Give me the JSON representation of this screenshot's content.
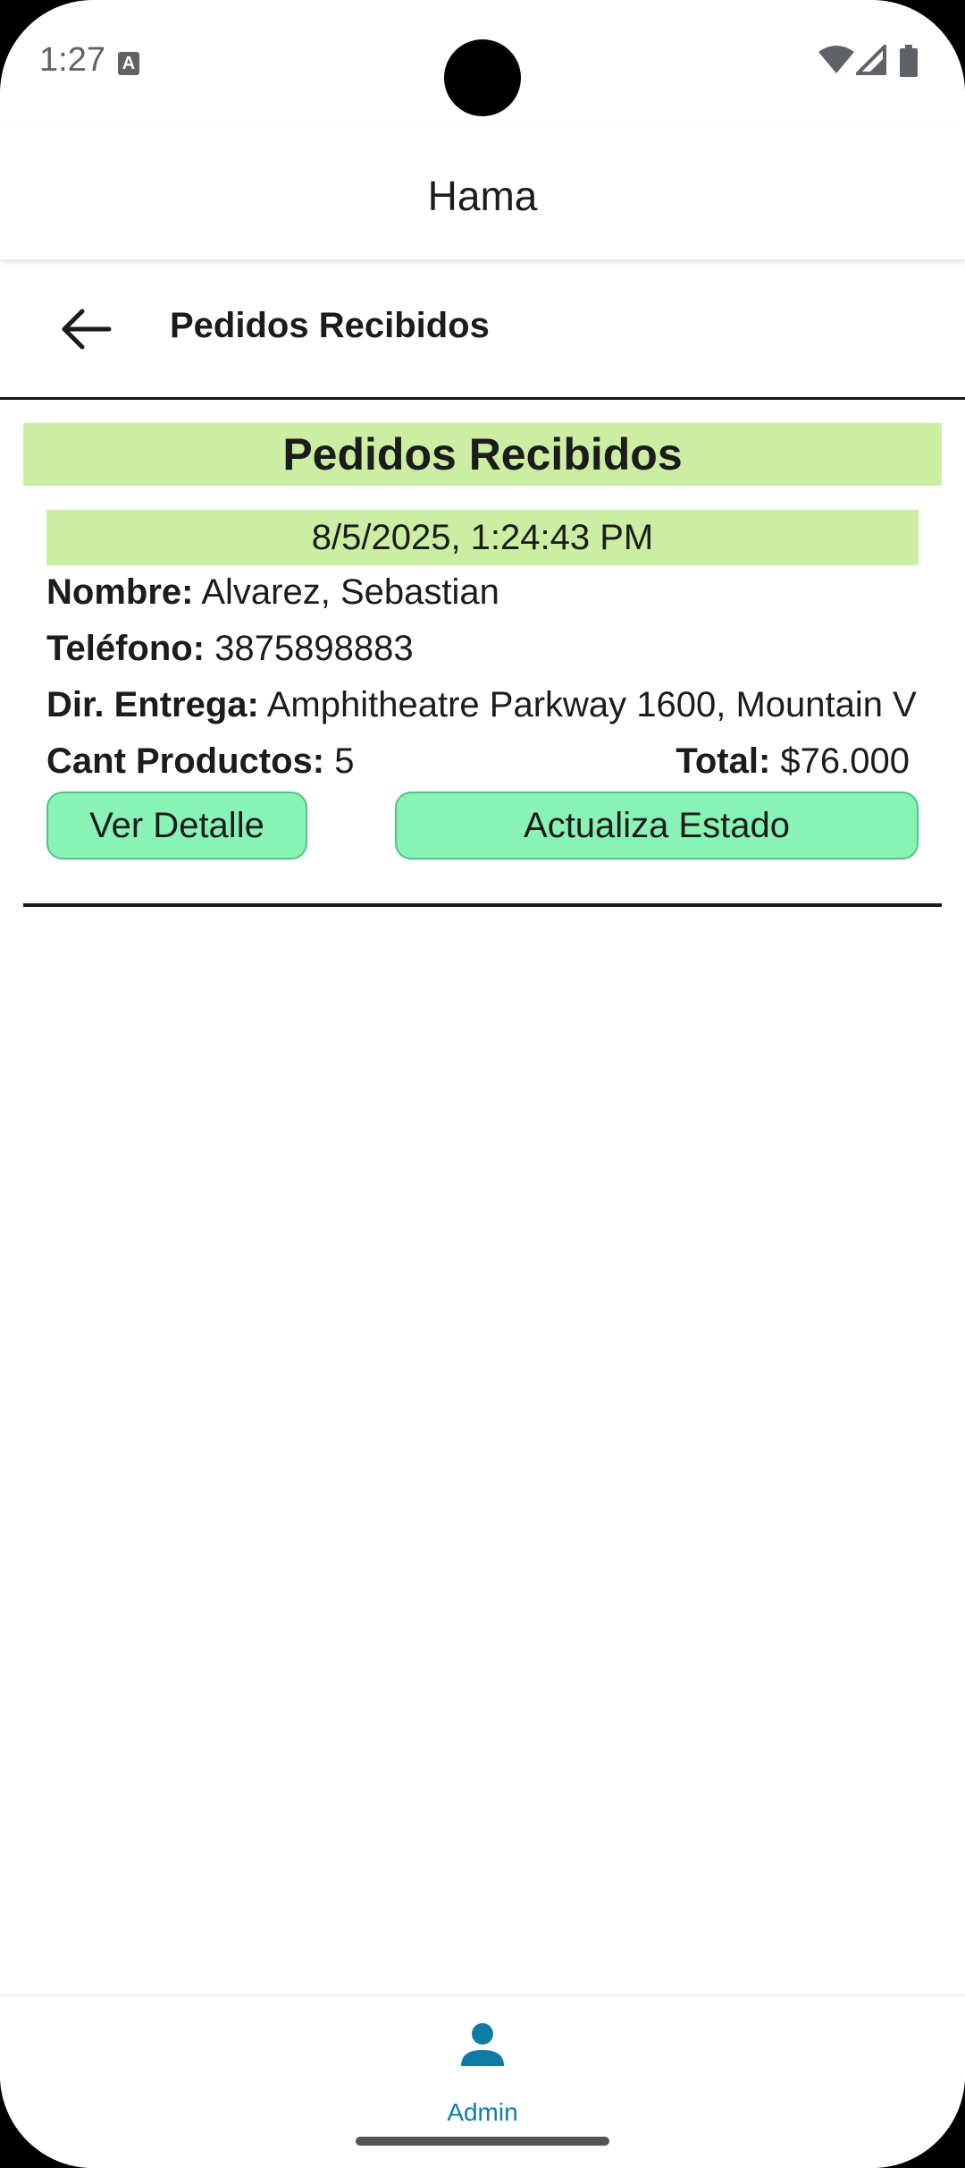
{
  "status_bar": {
    "time": "1:27",
    "notification_icon": "keyboard-a-icon",
    "icons": [
      "wifi-icon",
      "signal-icon",
      "battery-icon"
    ]
  },
  "app": {
    "title": "Hama"
  },
  "header": {
    "back_icon": "arrow-back-icon",
    "title": "Pedidos Recibidos"
  },
  "main": {
    "section_title": "Pedidos Recibidos",
    "orders": [
      {
        "date": "8/5/2025, 1:24:43 PM",
        "nombre_label": "Nombre:",
        "nombre": "Alvarez, Sebastian",
        "telefono_label": "Teléfono:",
        "telefono": "3875898883",
        "direccion_label": "Dir. Entrega:",
        "direccion": "Amphitheatre Parkway 1600, Mountain V",
        "cant_label": "Cant Productos:",
        "cant": "5",
        "total_label": "Total:",
        "total": "$76.000",
        "detail_button": "Ver Detalle",
        "estado_button": "Actualiza Estado"
      }
    ]
  },
  "bottom_nav": {
    "items": [
      {
        "label": "Admin",
        "icon": "person-icon"
      }
    ]
  },
  "colors": {
    "highlight": "#cbeea3",
    "button": "#88f3b5",
    "nav_active": "#0f7ca6"
  }
}
